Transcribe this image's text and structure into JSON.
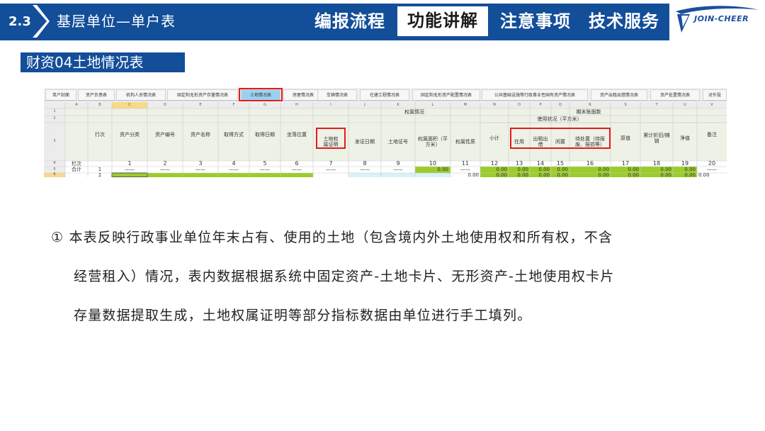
{
  "header": {
    "section_number": "2.3",
    "section_title": "基层单位—单户表",
    "nav": [
      {
        "label": "编报流程",
        "active": false
      },
      {
        "label": "功能讲解",
        "active": true
      },
      {
        "label": "注意事项",
        "active": false
      },
      {
        "label": "技术服务",
        "active": false
      }
    ],
    "logo_text": "JOIN-CHEER",
    "brand_color": "#134e99"
  },
  "sub_title": "财资04土地情况表",
  "sheet": {
    "tabs": [
      {
        "label": "单户封面",
        "active": false
      },
      {
        "label": "资产负债表",
        "active": false
      },
      {
        "label": "机构人员情况表",
        "active": false
      },
      {
        "label": "固定和无形资产存量情况表",
        "active": false
      },
      {
        "label": "土地情况表",
        "active": true
      },
      {
        "label": "房屋情况表",
        "active": false
      },
      {
        "label": "车辆情况表",
        "active": false
      },
      {
        "label": "在建工程情况表",
        "active": false
      },
      {
        "label": "固定和无形资产配置情况表",
        "active": false
      },
      {
        "label": "公共基础设施等行政事业性国有资产情况表",
        "active": false
      },
      {
        "label": "资产出租出借情况表",
        "active": false
      },
      {
        "label": "资产处置情况表",
        "active": false
      },
      {
        "label": "对外投",
        "active": false
      }
    ],
    "col_letters": [
      "A",
      "B",
      "C",
      "D",
      "E",
      "F",
      "G",
      "H",
      "I",
      "J",
      "K",
      "L",
      "M",
      "N",
      "O",
      "P",
      "Q",
      "R",
      "S",
      "T",
      "U",
      "V"
    ],
    "row_numbers": [
      "1",
      "2",
      "3",
      "4",
      "5",
      "6"
    ],
    "group_headers": {
      "ownership": "权属情况",
      "year_end": "期末账面数",
      "usage": "使用状况（平方米）"
    },
    "headers": {
      "seq": "行次",
      "category": "资产分类",
      "code": "资产编号",
      "name": "资产名称",
      "acquire_method": "取得方式",
      "acquire_date": "取得日期",
      "location": "坐落位置",
      "cert": "土地权属证明",
      "issue_date": "发证日期",
      "cert_no": "土地证号",
      "area": "权属面积（平方米）",
      "nature": "权属性质",
      "subtotal": "小计",
      "in_use": "在用",
      "lend": "出租出借",
      "idle": "闲置",
      "pending": "待处置（待报废、报损等）",
      "original": "原值",
      "depreciation": "累计折旧/摊销",
      "net": "净值",
      "remark": "备注"
    },
    "row_label_col": "栏次",
    "row_label_total": "合计",
    "col_numbers": [
      "1",
      "2",
      "3",
      "4",
      "5",
      "6",
      "7",
      "8",
      "9",
      "10",
      "11",
      "12",
      "13",
      "14",
      "15",
      "16",
      "17",
      "18",
      "19",
      "20"
    ],
    "total_row": {
      "seq": "1",
      "dashes": [
        "——",
        "——",
        "——",
        "——",
        "——",
        "——",
        "——",
        "——",
        "——",
        "——"
      ],
      "area": "0.00",
      "nature": "——",
      "values": [
        "0.00",
        "0.00",
        "0.00",
        "0.00",
        "0.00",
        "0.00",
        "0.00",
        "0.00",
        "0.00"
      ],
      "remark": "——"
    },
    "data_row": {
      "seq": "2",
      "area": "0.00",
      "values": [
        "0.00",
        "0.00",
        "0.00",
        "0.00",
        "0.00",
        "0.00",
        "0.00",
        "0.00",
        "0.00"
      ]
    }
  },
  "paragraphs": [
    "① 本表反映行政事业单位年末占有、使用的土地（包含境内外土地使用权和所有权，不含",
    "经营租入）情况，表内数据根据系统中固定资产-土地卡片、无形资产-土地使用权卡片",
    "存量数据提取生成，土地权属证明等部分指标数据由单位进行手工填列。"
  ]
}
